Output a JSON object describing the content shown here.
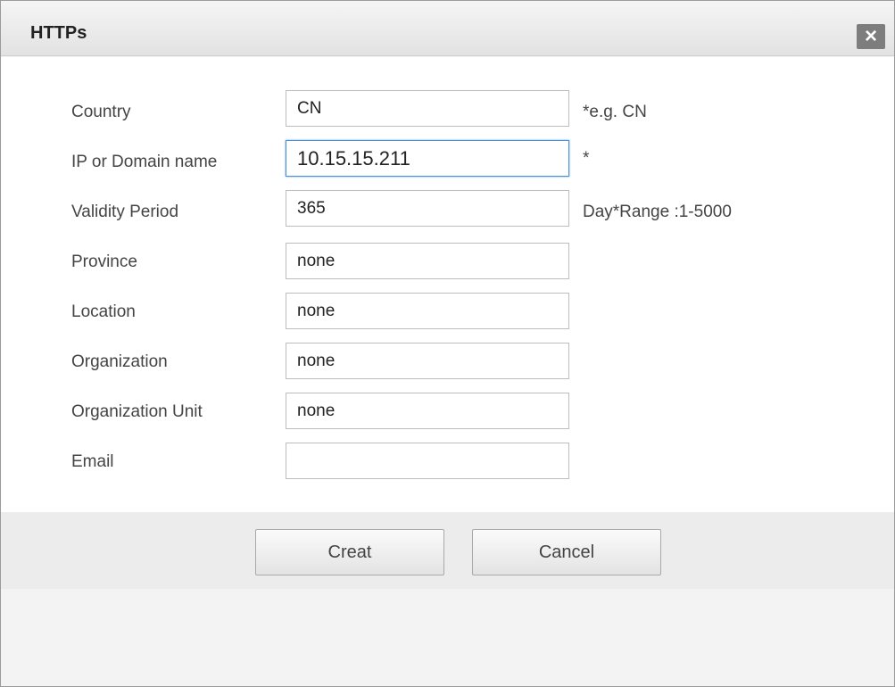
{
  "dialog": {
    "title": "HTTPs",
    "close_label": "×"
  },
  "form": {
    "fields": [
      {
        "label": "Country",
        "value": "CN",
        "hint": "*e.g. CN"
      },
      {
        "label": "IP or Domain name",
        "value": "10.15.15.211",
        "hint": "*"
      },
      {
        "label": "Validity Period",
        "value": "365",
        "hint": "Day*Range :1-5000"
      },
      {
        "label": "Province",
        "value": "none",
        "hint": ""
      },
      {
        "label": "Location",
        "value": "none",
        "hint": ""
      },
      {
        "label": "Organization",
        "value": "none",
        "hint": ""
      },
      {
        "label": "Organization Unit",
        "value": "none",
        "hint": ""
      },
      {
        "label": "Email",
        "value": "",
        "hint": ""
      }
    ]
  },
  "buttons": {
    "create_label": "Creat",
    "cancel_label": "Cancel"
  },
  "icons": {
    "close": "close-icon"
  }
}
